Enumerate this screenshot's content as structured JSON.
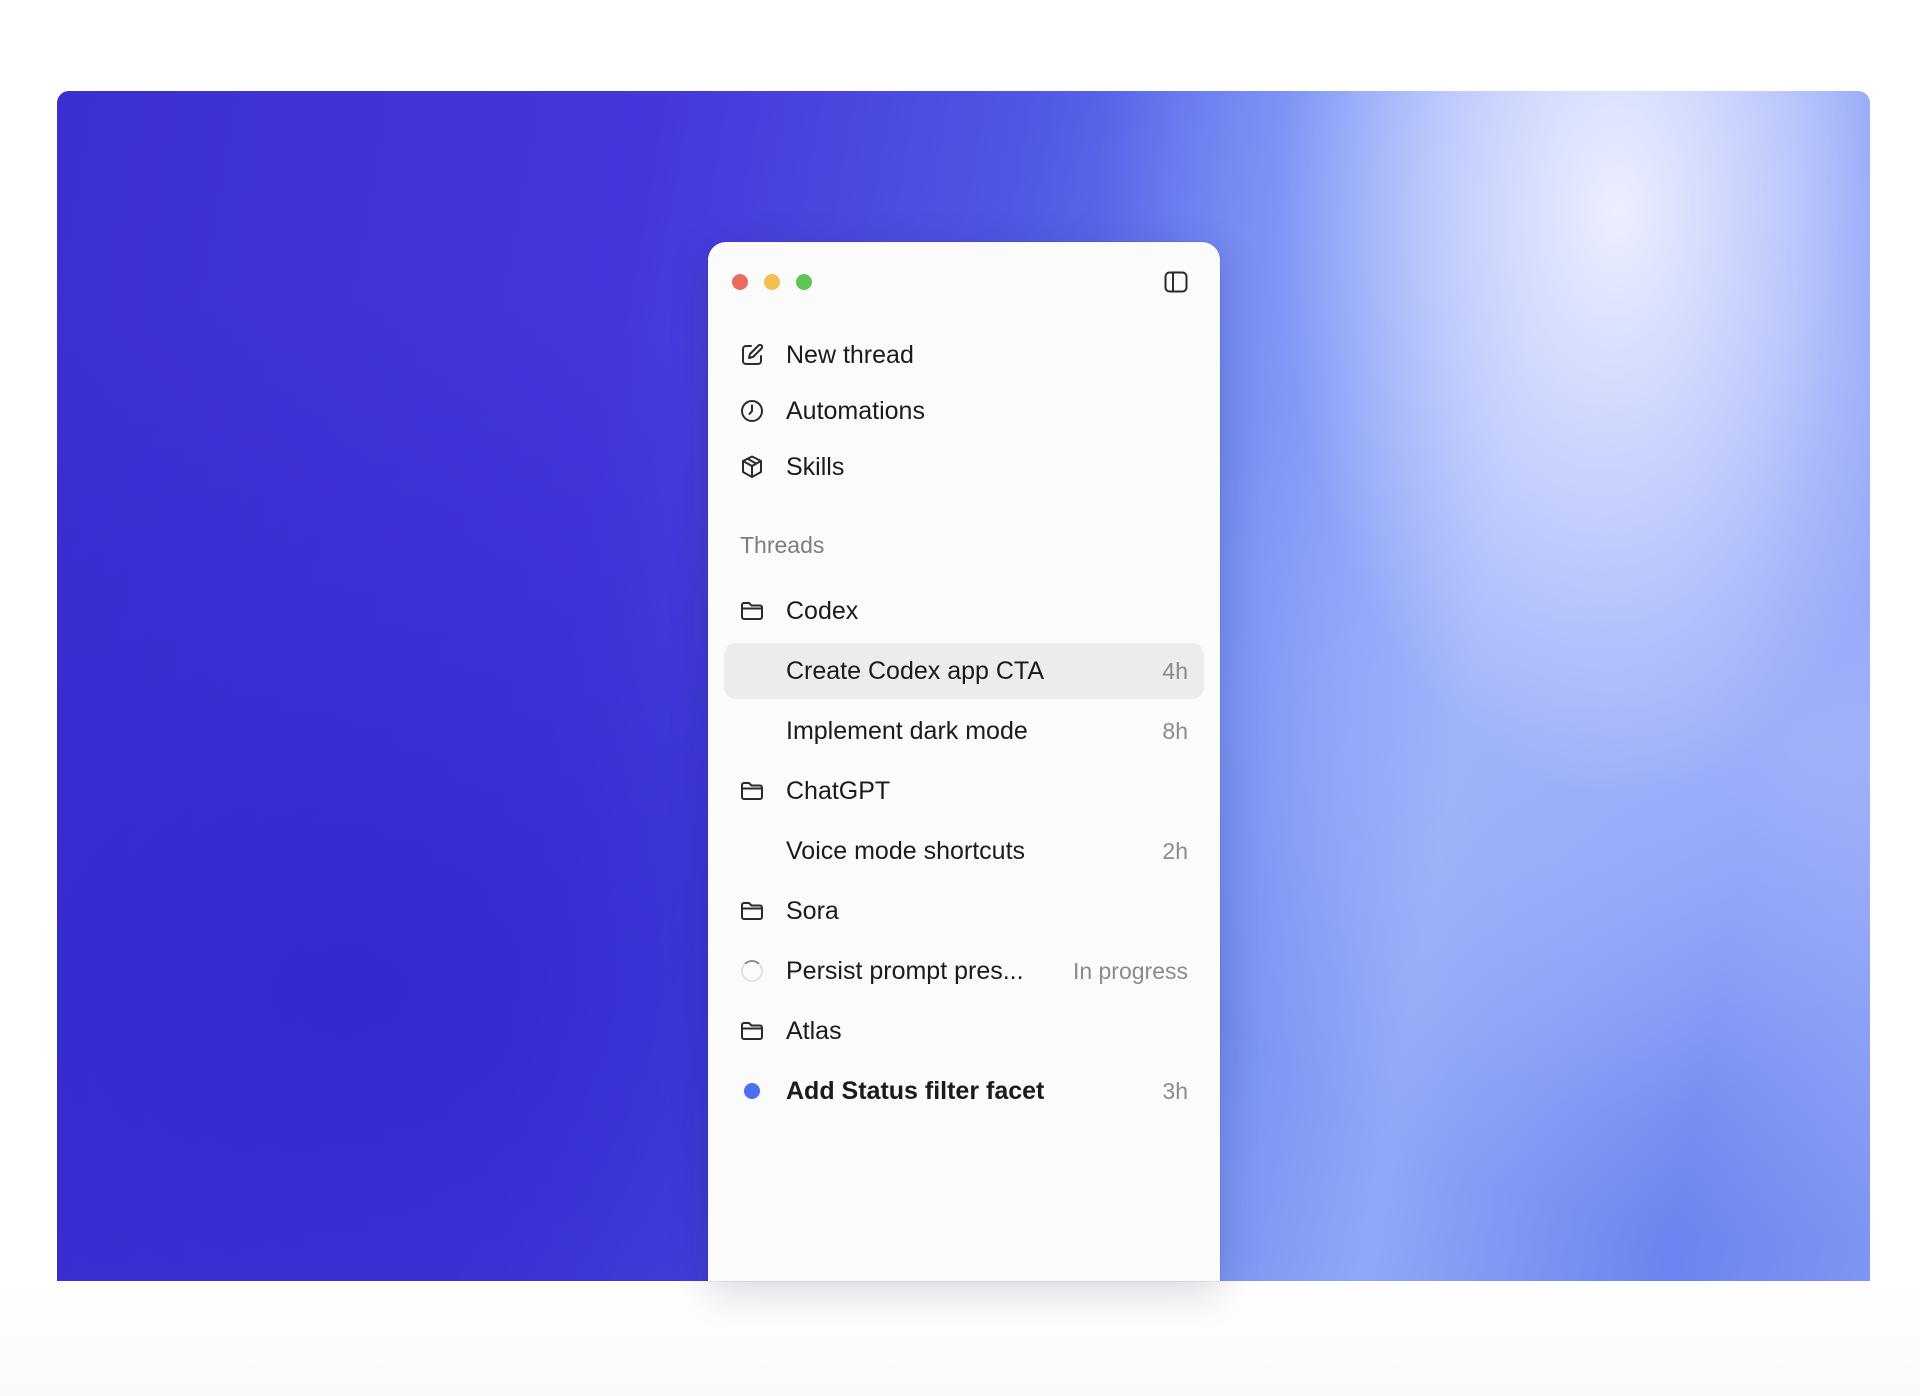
{
  "nav": {
    "items": [
      {
        "label": "New thread",
        "icon": "compose-icon"
      },
      {
        "label": "Automations",
        "icon": "clock-icon"
      },
      {
        "label": "Skills",
        "icon": "cube-icon"
      }
    ]
  },
  "threads": {
    "section_title": "Threads",
    "projects": [
      {
        "name": "Codex",
        "threads": [
          {
            "title": "Create Codex app CTA",
            "time": "4h",
            "selected": true
          },
          {
            "title": "Implement dark mode",
            "time": "8h"
          }
        ]
      },
      {
        "name": "ChatGPT",
        "threads": [
          {
            "title": "Voice mode shortcuts",
            "time": "2h"
          }
        ]
      },
      {
        "name": "Sora",
        "threads": [
          {
            "title": "Persist prompt pres...",
            "time": "In progress",
            "status": "in-progress"
          }
        ]
      },
      {
        "name": "Atlas",
        "threads": [
          {
            "title": "Add Status filter facet",
            "time": "3h",
            "status": "unread"
          }
        ]
      }
    ]
  },
  "colors": {
    "unread_dot": "#4c6ef0",
    "selected_row": "#ececee",
    "traffic_red": "#ec6a5e",
    "traffic_yellow": "#f4bf4f",
    "traffic_green": "#61c554"
  }
}
